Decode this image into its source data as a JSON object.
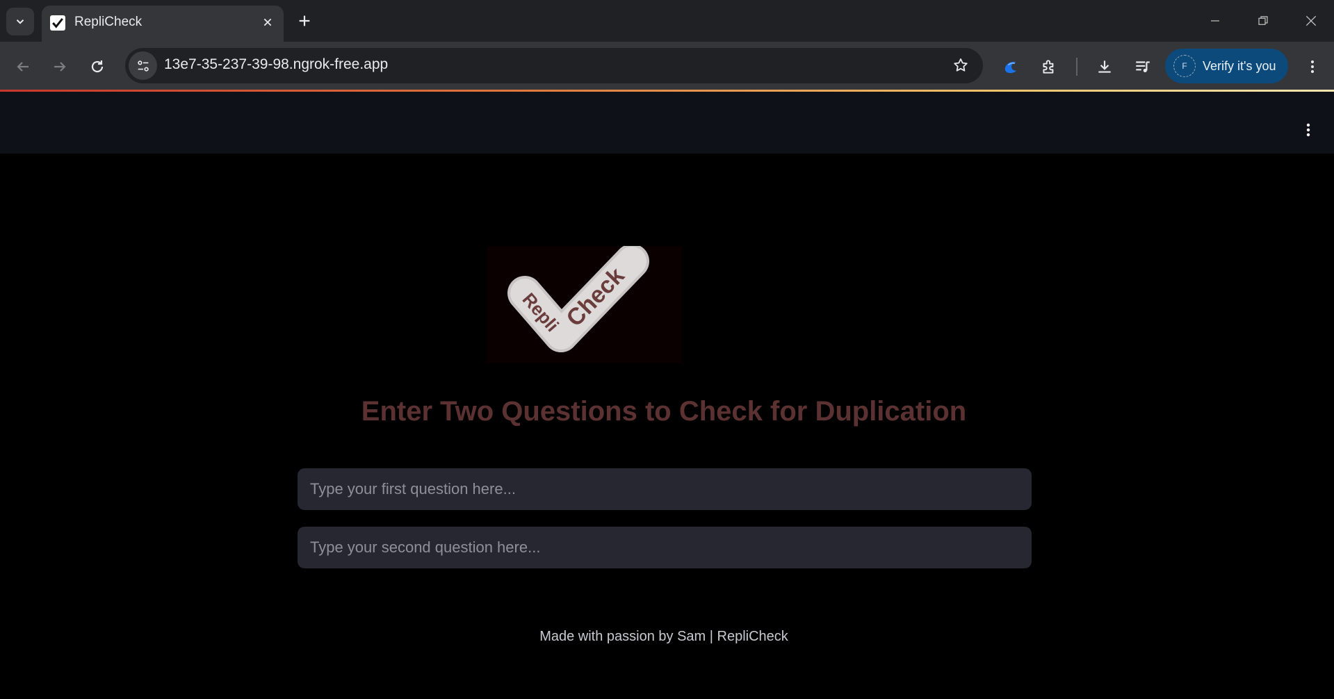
{
  "browser": {
    "tab": {
      "title": "RepliCheck"
    },
    "address_bar": {
      "url": "13e7-35-237-39-98.ngrok-free.app"
    },
    "profile_button": {
      "avatar_letter": "F",
      "label": "Verify it's you"
    }
  },
  "page": {
    "logo": {
      "word_left": "Repli",
      "word_right": "Check"
    },
    "heading": "Enter Two Questions to Check for Duplication",
    "question1": {
      "placeholder": "Type your first question here...",
      "value": ""
    },
    "question2": {
      "placeholder": "Type your second question here...",
      "value": ""
    },
    "footer": "Made with passion by Sam | RepliCheck"
  },
  "colors": {
    "heading": "#5b3131",
    "input_bg": "#262730",
    "header_bg": "#0e1117",
    "verify_button_bg": "#0b4a7a"
  }
}
